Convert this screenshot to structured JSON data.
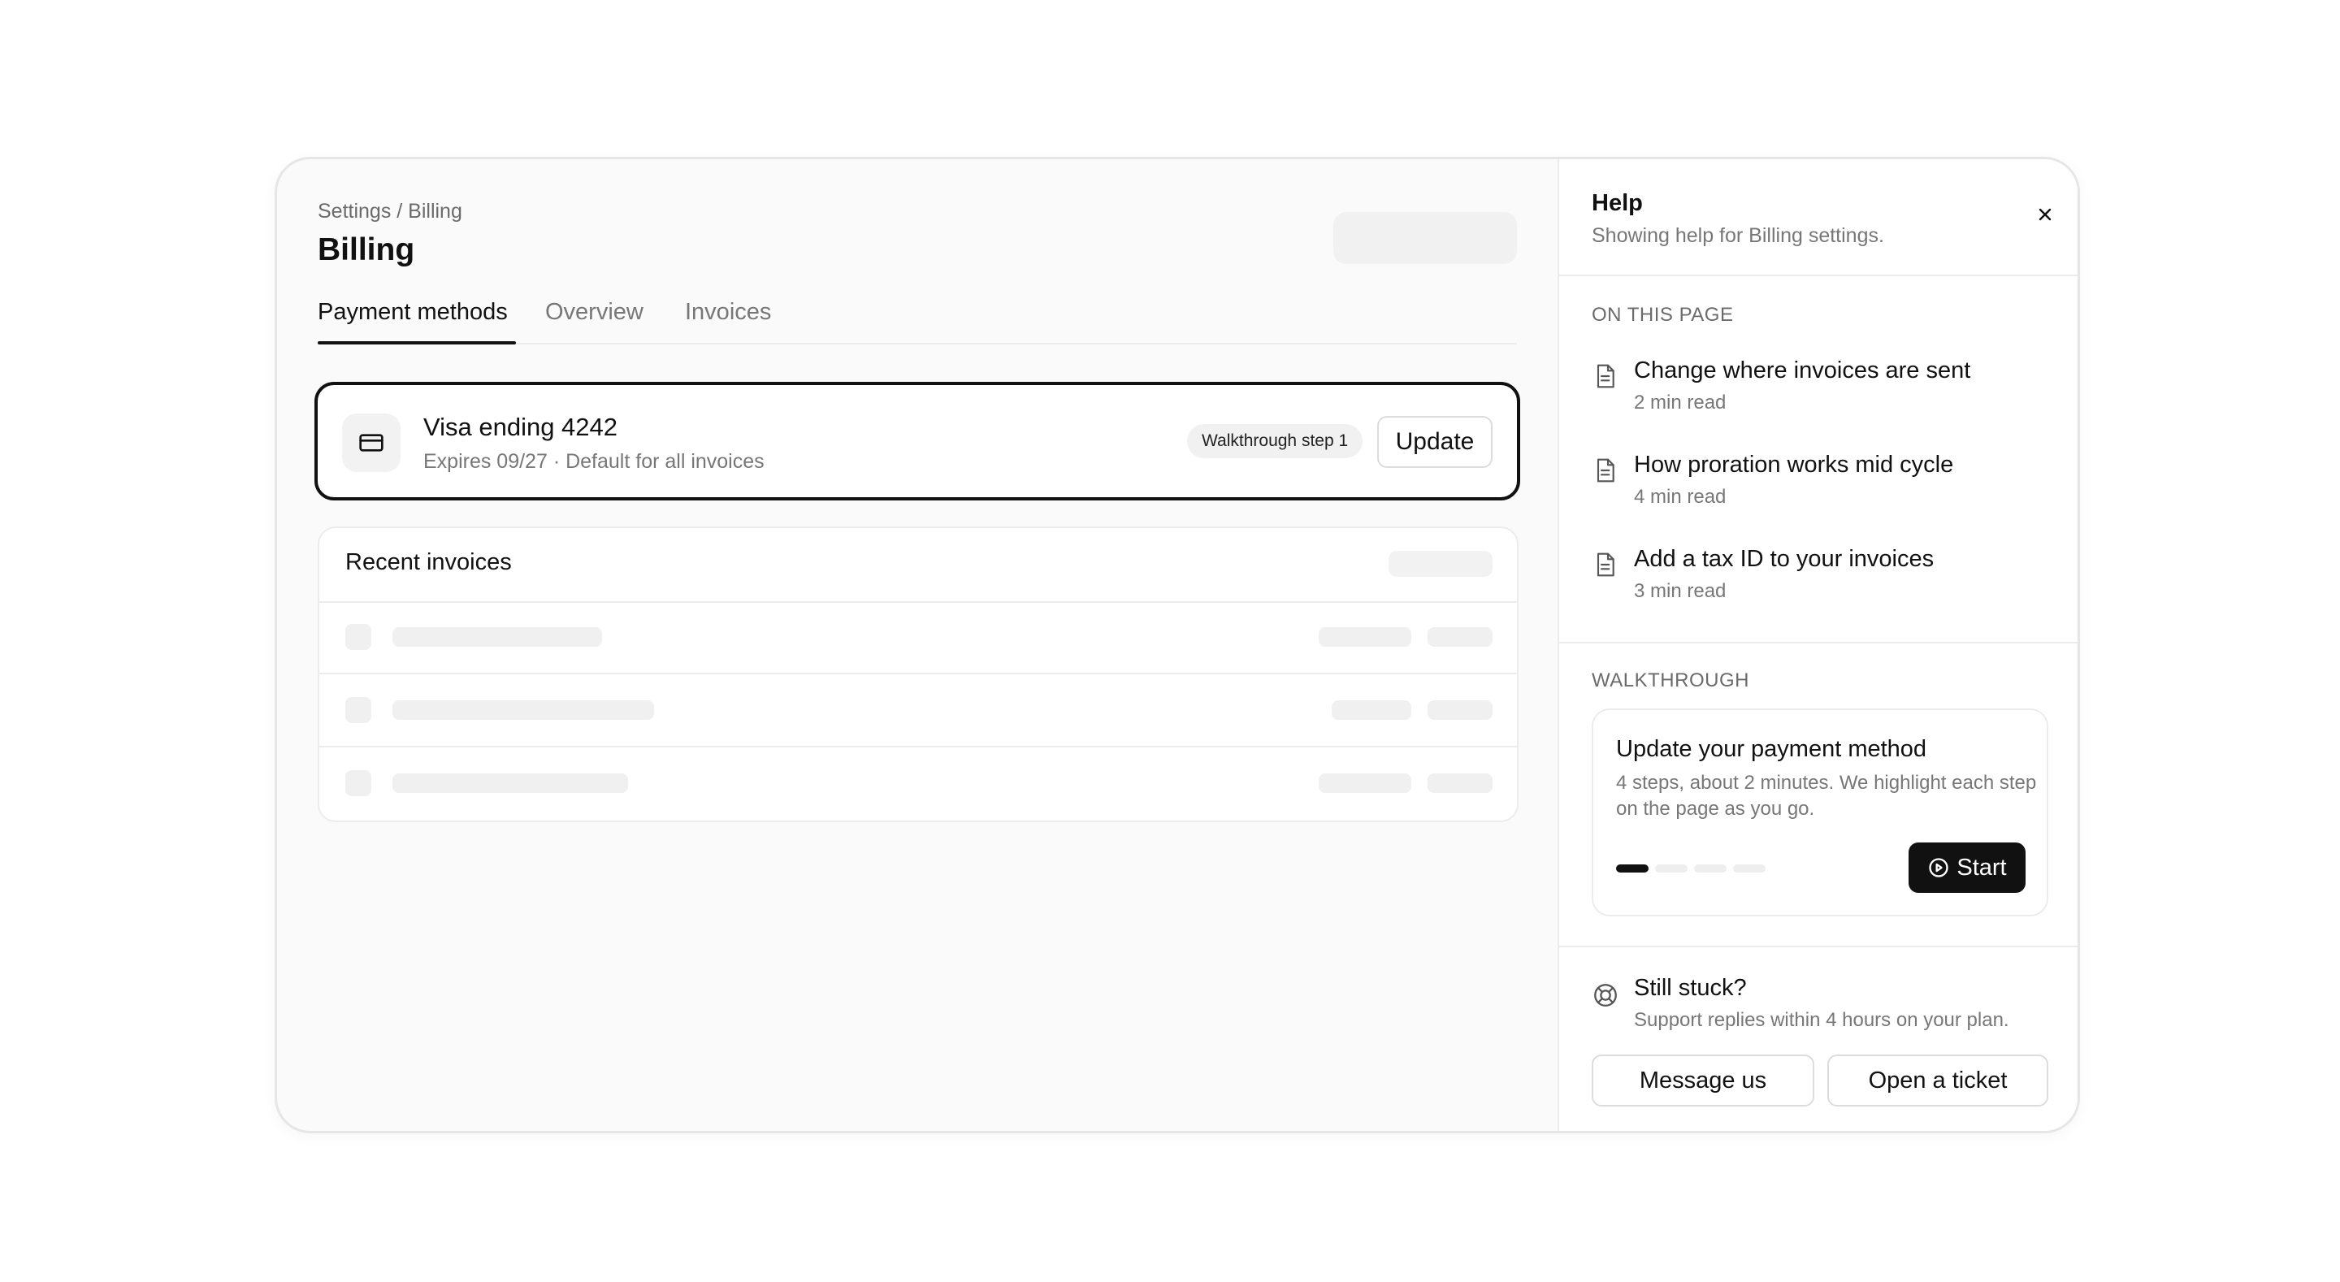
{
  "breadcrumb": "Settings / Billing",
  "page_title": "Billing",
  "tabs": [
    {
      "label": "Payment methods",
      "active": true
    },
    {
      "label": "Overview",
      "active": false
    },
    {
      "label": "Invoices",
      "active": false
    }
  ],
  "payment_card": {
    "icon": "credit-card-icon",
    "title": "Visa ending 4242",
    "subtitle": "Expires 09/27 · Default for all invoices",
    "badge": "Walkthrough step 1",
    "update_label": "Update"
  },
  "recent_invoices": {
    "title": "Recent invoices"
  },
  "help": {
    "title": "Help",
    "subtitle": "Showing help for Billing settings.",
    "close_icon": "close-icon",
    "on_this_page_label": "ON THIS PAGE",
    "articles": [
      {
        "title": "Change where invoices are sent",
        "meta": "2 min read",
        "icon": "document-icon"
      },
      {
        "title": "How proration works mid cycle",
        "meta": "4 min read",
        "icon": "document-icon"
      },
      {
        "title": "Add a tax ID to your invoices",
        "meta": "3 min read",
        "icon": "document-icon"
      }
    ],
    "walkthrough_label": "WALKTHROUGH",
    "walkthrough": {
      "title": "Update your payment method",
      "description": "4 steps, about 2 minutes. We highlight each step on the page as you go.",
      "steps_total": 4,
      "current_step": 1,
      "start_label": "Start",
      "start_icon": "play-circle-icon"
    },
    "stuck": {
      "icon": "lifebuoy-icon",
      "title": "Still stuck?",
      "subtitle": "Support replies within 4 hours on your plan.",
      "message_label": "Message us",
      "ticket_label": "Open a ticket"
    }
  },
  "colors": {
    "accent": "#111111",
    "muted_text": "#777777",
    "border": "#ececec",
    "skeleton": "#f0f0f0"
  }
}
